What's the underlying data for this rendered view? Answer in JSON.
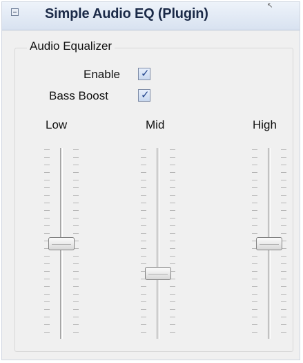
{
  "window": {
    "title": "Simple Audio EQ (Plugin)"
  },
  "group": {
    "label": "Audio Equalizer"
  },
  "options": {
    "enable": {
      "label": "Enable",
      "checked": true
    },
    "bass_boost": {
      "label": "Bass Boost",
      "checked": true
    }
  },
  "bands": [
    {
      "label": "Low",
      "level": 0.5
    },
    {
      "label": "Mid",
      "level": 0.33
    },
    {
      "label": "High",
      "level": 0.5
    }
  ],
  "icons": {
    "collapse": "collapse-icon",
    "check": "check-icon",
    "cursor": "cursor-icon"
  },
  "colors": {
    "title_text": "#1b2a48",
    "title_bar_top": "#eef3fa",
    "title_bar_bottom": "#d8e2f0",
    "check_mark": "#20438c"
  }
}
